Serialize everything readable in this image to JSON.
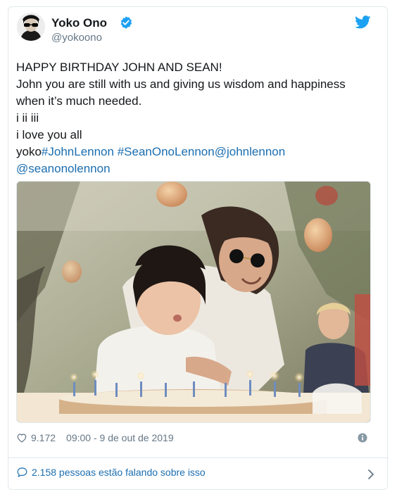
{
  "user": {
    "name": "Yoko Ono",
    "handle": "@yokoono"
  },
  "tweet": {
    "line1": "HAPPY BIRTHDAY JOHN AND SEAN!",
    "line2": "John you are still with us and giving us wisdom and happiness",
    "line3": "when it’s much needed.",
    "line4": "i ii iii",
    "line5": "i love you all",
    "line6_prefix": "yoko",
    "hashtag1": "#JohnLennon",
    "hashtag2": "#SeanOnoLennon",
    "mention1": "@johnlennon",
    "mention2": "@seanonolennon"
  },
  "meta": {
    "likes": "9.172",
    "timestamp": "09:00 - 9 de out de 2019"
  },
  "footer": {
    "talking": "2.158 pessoas estão falando sobre isso"
  },
  "colors": {
    "link": "#1b6eb0",
    "verified": "#1da1f2",
    "twitter": "#1da1f2",
    "muted": "#657786"
  },
  "icons": [
    "verified-badge-icon",
    "twitter-bird-icon",
    "heart-icon",
    "info-icon",
    "speech-bubble-icon",
    "chevron-right-icon"
  ]
}
